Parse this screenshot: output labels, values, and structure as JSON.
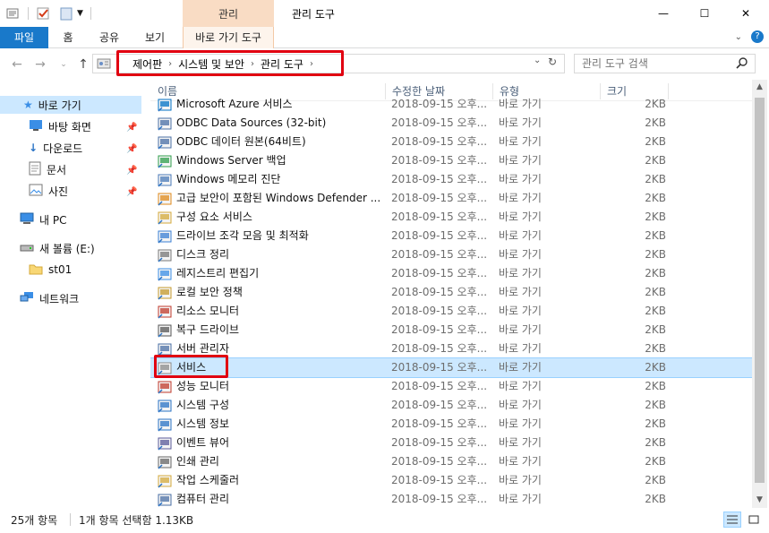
{
  "titlebar": {
    "context_tab": "관리",
    "title": "관리 도구",
    "minimize": "—",
    "maximize": "☐",
    "close": "✕"
  },
  "ribbon": {
    "tabs": [
      "파일",
      "홈",
      "공유",
      "보기"
    ],
    "context_subtab": "바로 가기 도구",
    "help": "?"
  },
  "address": {
    "breadcrumbs": [
      "제어판",
      "시스템 및 보안",
      "관리 도구"
    ],
    "search_placeholder": "관리 도구 검색"
  },
  "navpane": {
    "quick_access": "바로 가기",
    "quick_items": [
      "바탕 화면",
      "다운로드",
      "문서",
      "사진"
    ],
    "this_pc": "내 PC",
    "drive": "새 볼륨 (E:)",
    "folder": "st01",
    "network": "네트워크"
  },
  "columns": {
    "name": "이름",
    "date": "수정한 날짜",
    "type": "유형",
    "size": "크기"
  },
  "files": [
    {
      "name": "Microsoft Azure 서비스",
      "date": "2018-09-15 오후...",
      "type": "바로 가기",
      "size": "2KB",
      "icon": "azure-icon"
    },
    {
      "name": "ODBC Data Sources (32-bit)",
      "date": "2018-09-15 오후...",
      "type": "바로 가기",
      "size": "2KB",
      "icon": "odbc-icon"
    },
    {
      "name": "ODBC 데이터 원본(64비트)",
      "date": "2018-09-15 오후...",
      "type": "바로 가기",
      "size": "2KB",
      "icon": "odbc-icon"
    },
    {
      "name": "Windows Server 백업",
      "date": "2018-09-15 오후...",
      "type": "바로 가기",
      "size": "2KB",
      "icon": "backup-icon"
    },
    {
      "name": "Windows 메모리 진단",
      "date": "2018-09-15 오후...",
      "type": "바로 가기",
      "size": "2KB",
      "icon": "memory-icon"
    },
    {
      "name": "고급 보안이 포함된 Windows Defender ...",
      "date": "2018-09-15 오후...",
      "type": "바로 가기",
      "size": "2KB",
      "icon": "firewall-icon"
    },
    {
      "name": "구성 요소 서비스",
      "date": "2018-09-15 오후...",
      "type": "바로 가기",
      "size": "2KB",
      "icon": "component-icon"
    },
    {
      "name": "드라이브 조각 모음 및 최적화",
      "date": "2018-09-15 오후...",
      "type": "바로 가기",
      "size": "2KB",
      "icon": "defrag-icon"
    },
    {
      "name": "디스크 정리",
      "date": "2018-09-15 오후...",
      "type": "바로 가기",
      "size": "2KB",
      "icon": "cleanup-icon"
    },
    {
      "name": "레지스트리 편집기",
      "date": "2018-09-15 오후...",
      "type": "바로 가기",
      "size": "2KB",
      "icon": "registry-icon"
    },
    {
      "name": "로컬 보안 정책",
      "date": "2018-09-15 오후...",
      "type": "바로 가기",
      "size": "2KB",
      "icon": "policy-icon"
    },
    {
      "name": "리소스 모니터",
      "date": "2018-09-15 오후...",
      "type": "바로 가기",
      "size": "2KB",
      "icon": "monitor-icon"
    },
    {
      "name": "복구 드라이브",
      "date": "2018-09-15 오후...",
      "type": "바로 가기",
      "size": "2KB",
      "icon": "recovery-icon"
    },
    {
      "name": "서버 관리자",
      "date": "2018-09-15 오후...",
      "type": "바로 가기",
      "size": "2KB",
      "icon": "server-icon"
    },
    {
      "name": "서비스",
      "date": "2018-09-15 오후...",
      "type": "바로 가기",
      "size": "2KB",
      "icon": "services-icon",
      "selected": true
    },
    {
      "name": "성능 모니터",
      "date": "2018-09-15 오후...",
      "type": "바로 가기",
      "size": "2KB",
      "icon": "perf-icon"
    },
    {
      "name": "시스템 구성",
      "date": "2018-09-15 오후...",
      "type": "바로 가기",
      "size": "2KB",
      "icon": "sysconfig-icon"
    },
    {
      "name": "시스템 정보",
      "date": "2018-09-15 오후...",
      "type": "바로 가기",
      "size": "2KB",
      "icon": "sysinfo-icon"
    },
    {
      "name": "이벤트 뷰어",
      "date": "2018-09-15 오후...",
      "type": "바로 가기",
      "size": "2KB",
      "icon": "event-icon"
    },
    {
      "name": "인쇄 관리",
      "date": "2018-09-15 오후...",
      "type": "바로 가기",
      "size": "2KB",
      "icon": "print-icon"
    },
    {
      "name": "작업 스케줄러",
      "date": "2018-09-15 오후...",
      "type": "바로 가기",
      "size": "2KB",
      "icon": "scheduler-icon"
    },
    {
      "name": "컴퓨터 관리",
      "date": "2018-09-15 오후...",
      "type": "바로 가기",
      "size": "2KB",
      "icon": "computer-mgmt-icon"
    }
  ],
  "status": {
    "count": "25개 항목",
    "selection": "1개 항목 선택함 1.13KB"
  },
  "colors": {
    "accent": "#1979ca",
    "selection": "#cce8ff",
    "context_tab": "#f9dcc4",
    "highlight_box": "#e10010"
  }
}
